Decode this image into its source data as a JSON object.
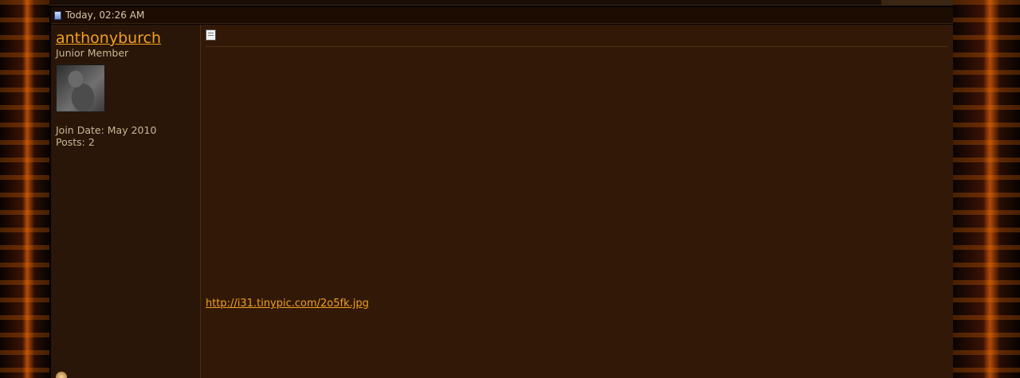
{
  "post": {
    "date": "Today, 02:26 AM"
  },
  "user": {
    "name": "anthonyburch",
    "title": "Junior Member",
    "join_date": "Join Date: May 2010",
    "posts": "Posts: 2"
  },
  "content": {
    "title_highlight": "",
    "title_rest": "",
    "paragraphs": [],
    "link": "http://i31.tinypic.com/2o5fk.jpg"
  }
}
